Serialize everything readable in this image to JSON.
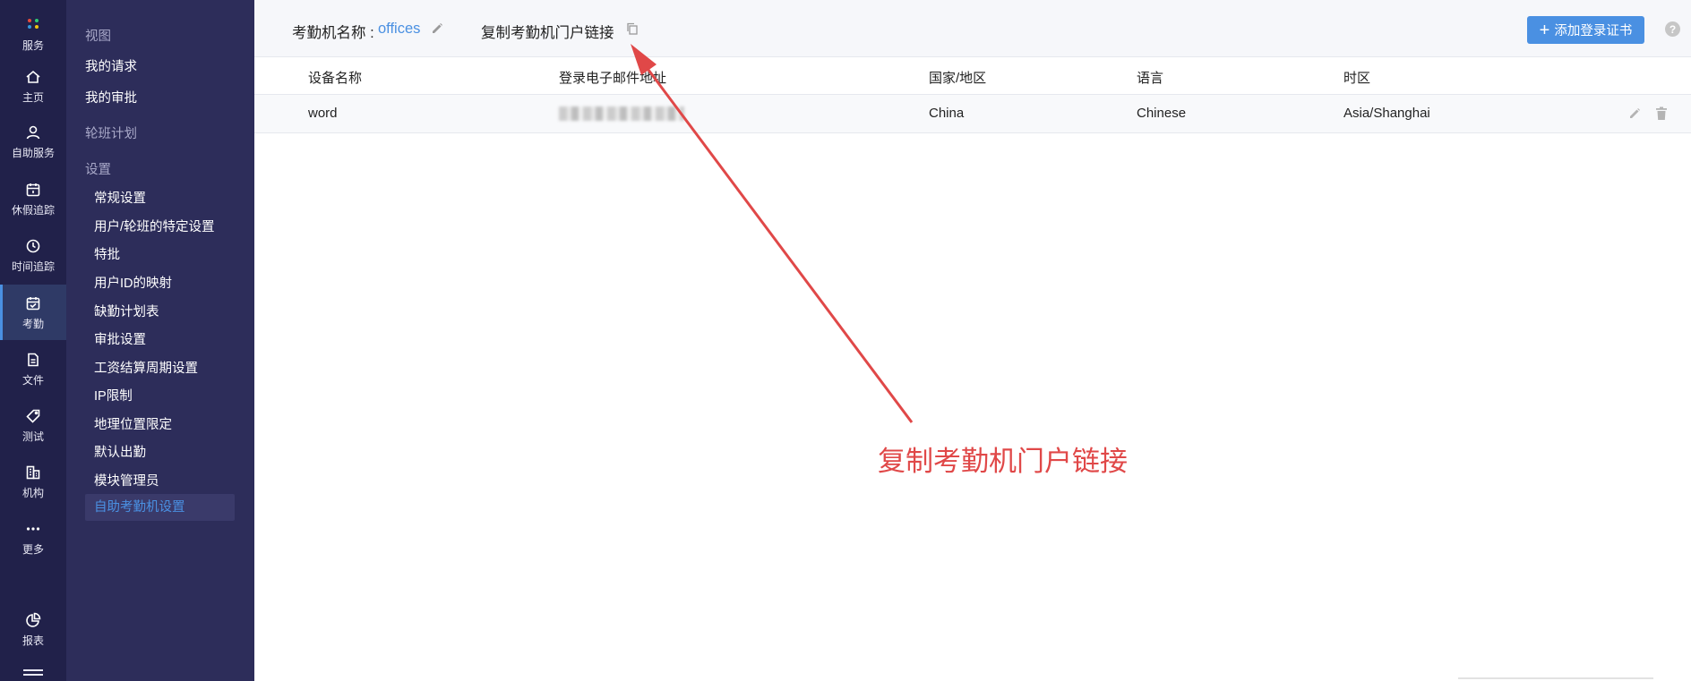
{
  "rail": {
    "items": [
      {
        "label": "服务",
        "icon": "apps-dots-icon"
      },
      {
        "label": "主页",
        "icon": "home-icon"
      },
      {
        "label": "自助服务",
        "icon": "user-icon"
      },
      {
        "label": "休假追踪",
        "icon": "calendar-icon"
      },
      {
        "label": "时间追踪",
        "icon": "clock-icon"
      },
      {
        "label": "考勤",
        "icon": "calendar-check-icon"
      },
      {
        "label": "文件",
        "icon": "file-icon"
      },
      {
        "label": "测试",
        "icon": "tag-icon"
      },
      {
        "label": "机构",
        "icon": "building-icon"
      },
      {
        "label": "更多",
        "icon": "more-dots-icon"
      },
      {
        "label": "报表",
        "icon": "pie-chart-icon"
      }
    ],
    "active_item": "考勤"
  },
  "submenu": {
    "views_header": "视图",
    "my_requests": "我的请求",
    "my_approvals": "我的审批",
    "shift_plan": "轮班计划",
    "settings_header": "设置",
    "settings_items": [
      "常规设置",
      "用户/轮班的特定设置",
      "特批",
      "用户ID的映射",
      "缺勤计划表",
      "审批设置",
      "工资结算周期设置",
      "IP限制",
      "地理位置限定",
      "默认出勤",
      "模块管理员",
      "自助考勤机设置"
    ],
    "active_setting": "自助考勤机设置"
  },
  "topbar": {
    "name_label": "考勤机名称 :",
    "name_value": "offices",
    "copy_link_label": "复制考勤机门户链接",
    "add_button_label": "添加登录证书",
    "help_label": "?"
  },
  "table": {
    "columns": [
      "设备名称",
      "登录电子邮件地址",
      "国家/地区",
      "语言",
      "时区"
    ],
    "rows": [
      {
        "device": "word",
        "email": "",
        "country": "China",
        "language": "Chinese",
        "timezone": "Asia/Shanghai"
      }
    ]
  },
  "annotation": {
    "text": "复制考勤机门户链接",
    "color": "#e04848"
  },
  "colors": {
    "rail_bg": "#21214a",
    "submenu_bg": "#2d2d5a",
    "accent": "#4a90e2"
  }
}
